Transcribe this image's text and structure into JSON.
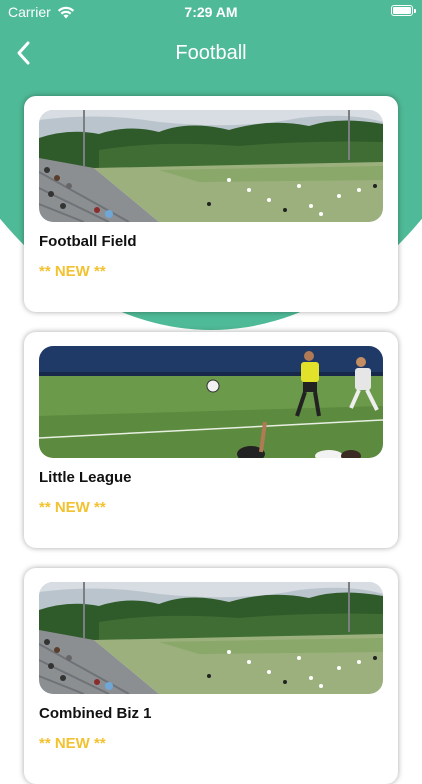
{
  "status_bar": {
    "carrier": "Carrier",
    "time": "7:29 AM"
  },
  "nav": {
    "title": "Football",
    "back_icon": "chevron-left-icon"
  },
  "colors": {
    "accent": "#4fba97",
    "badge": "#f2c230"
  },
  "cards": [
    {
      "title": "Football Field",
      "badge": "** NEW **",
      "image": "stadium-field-photo"
    },
    {
      "title": "Little League",
      "badge": "** NEW **",
      "image": "soccer-match-photo"
    },
    {
      "title": "Combined Biz 1",
      "badge": "** NEW **",
      "image": "stadium-field-photo"
    }
  ]
}
